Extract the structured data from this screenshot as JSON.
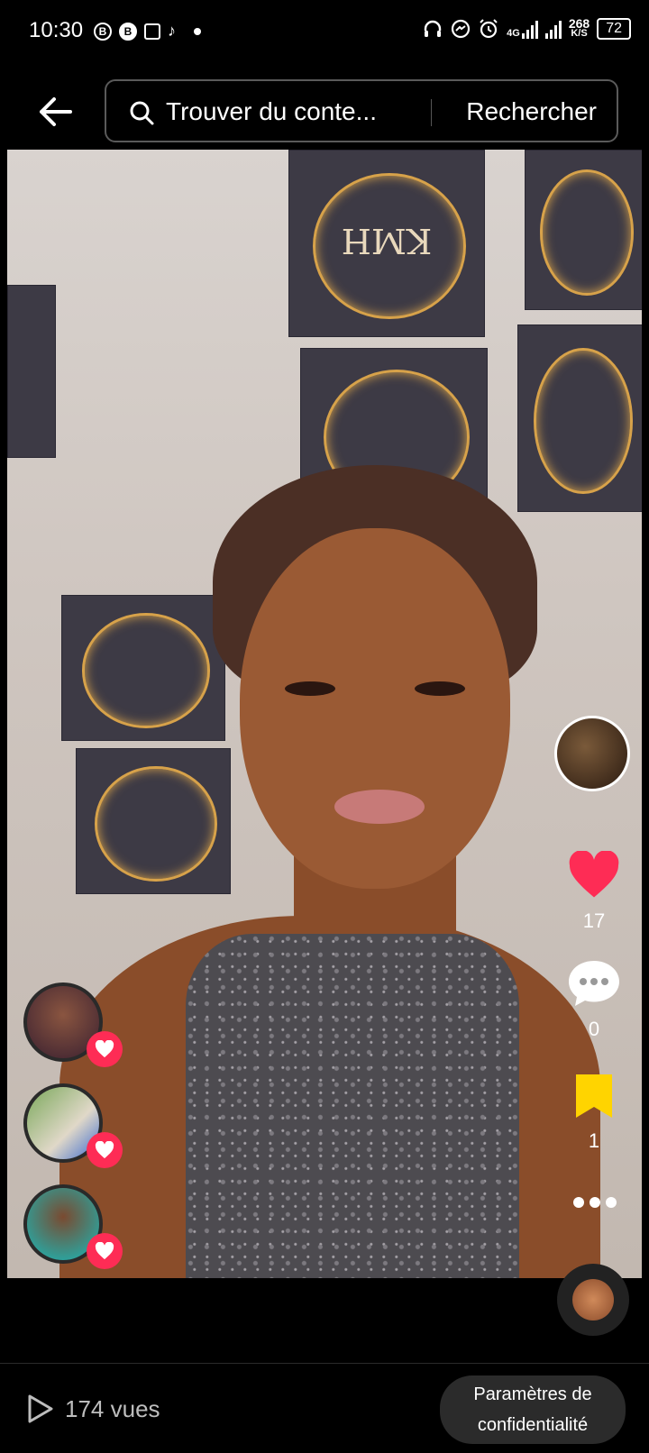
{
  "status_bar": {
    "time": "10:30",
    "network": "4G",
    "speed_value": "268",
    "speed_unit": "K/S",
    "battery": "72"
  },
  "search": {
    "query": "Trouver du conte...",
    "button_label": "Rechercher"
  },
  "video": {
    "poster_text": "KMH"
  },
  "actions": {
    "likes": "17",
    "comments": "0",
    "saves": "1"
  },
  "footer": {
    "views": "174 vues",
    "privacy_line1": "Paramètres de",
    "privacy_line2": "confidentialité"
  },
  "colors": {
    "like_red": "#fe2c55",
    "bookmark_yellow": "#ffd400"
  }
}
